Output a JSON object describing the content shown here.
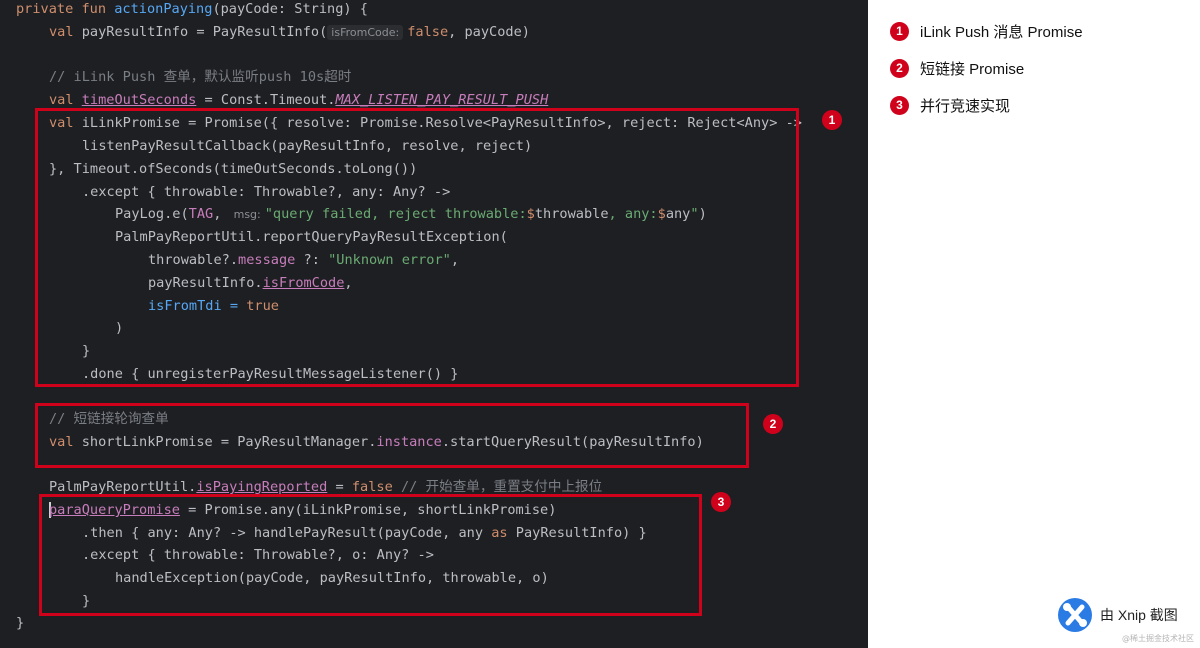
{
  "code": {
    "l1": {
      "kw1": "private fun ",
      "fn": "actionPaying",
      "rest": "(payCode: String) {"
    },
    "l2": {
      "kw": "val ",
      "a": "payResultInfo = PayResultInfo(",
      "hint": "isFromCode:",
      "kw2": "false",
      ", payCode)": "",
      "b": ", payCode)"
    },
    "l3": {
      "cm": "// iLink Push 查单，默认监听push 10s超时"
    },
    "l4": {
      "kw": "val ",
      "var": "timeOutSeconds",
      "a": " = Const.Timeout.",
      "const": "MAX_LISTEN_PAY_RESULT_PUSH"
    },
    "l5": {
      "kw": "val ",
      "a": "iLinkPromise = Promise({ resolve: Promise.Resolve<PayResultInfo>, reject: Reject<Any> ->"
    },
    "l6": {
      "a": "listenPayResultCallback(payResultInfo, resolve, reject)"
    },
    "l7": {
      "a": "}, Timeout.ofSeconds(timeOutSeconds.toLong())"
    },
    "l8": {
      "a": ".except { throwable: Throwable?, any: Any? ->"
    },
    "l9": {
      "a": "PayLog.e(",
      "tag": "TAG",
      "c": ", ",
      "hint": "msg:",
      "str1": "\"query failed, reject throwable:",
      "d1": "$",
      "v1": "throwable",
      "str2": ", any:",
      "d2": "$",
      "v2": "any",
      "str3": "\"",
      ")": ")",
      "end": ")"
    },
    "l10": {
      "a": "PalmPayReportUtil.reportQueryPayResultException("
    },
    "l11": {
      "a": "throwable?.",
      "prop": "message",
      "b": " ?: ",
      "str": "\"Unknown error\"",
      "c": ","
    },
    "l12": {
      "a": "payResultInfo.",
      "prop": "isFromCode",
      "b": ","
    },
    "l13": {
      "name": "isFromTdi",
      "eq": " = ",
      "kw": "true"
    },
    "l14": {
      "a": ")"
    },
    "l15": {
      "a": "}"
    },
    "l16": {
      "a": ".done { unregisterPayResultMessageListener() }"
    },
    "l17": {
      "cm": "// 短链接轮询查单"
    },
    "l18": {
      "kw": "val ",
      "a": "shortLinkPromise = PayResultManager.",
      "prop": "instance",
      "b": ".startQueryResult(payResultInfo)"
    },
    "l19": {
      "a": "PalmPayReportUtil.",
      "prop": "isPayingReported",
      "b": " = ",
      "kw": "false",
      "cm": " // 开始查单，重置支付中上报位"
    },
    "l20": {
      "prop": "paraQueryPromise",
      "a": " = Promise.any(iLinkPromise, shortLinkPromise)"
    },
    "l21": {
      "a": ".then { any: Any? -> handlePayResult(payCode, any ",
      "kw": "as",
      "b": " PayResultInfo) }"
    },
    "l22": {
      "a": ".except { throwable: Throwable?, o: Any? ->"
    },
    "l23": {
      "a": "handleException(payCode, payResultInfo, throwable, o)"
    },
    "l24": {
      "a": "}"
    },
    "l25": {
      "a": "}"
    }
  },
  "markers": [
    "1",
    "2",
    "3"
  ],
  "legend": [
    {
      "num": "1",
      "label": "iLink Push 消息 Promise"
    },
    {
      "num": "2",
      "label": "短链接 Promise"
    },
    {
      "num": "3",
      "label": "并行竞速实现"
    }
  ],
  "watermark_app": "由 Xnip 截图",
  "watermark_site": "@稀土掘金技术社区",
  "colors": {
    "highlight_box": "#d0021b",
    "editor_bg": "#1e1f22"
  }
}
